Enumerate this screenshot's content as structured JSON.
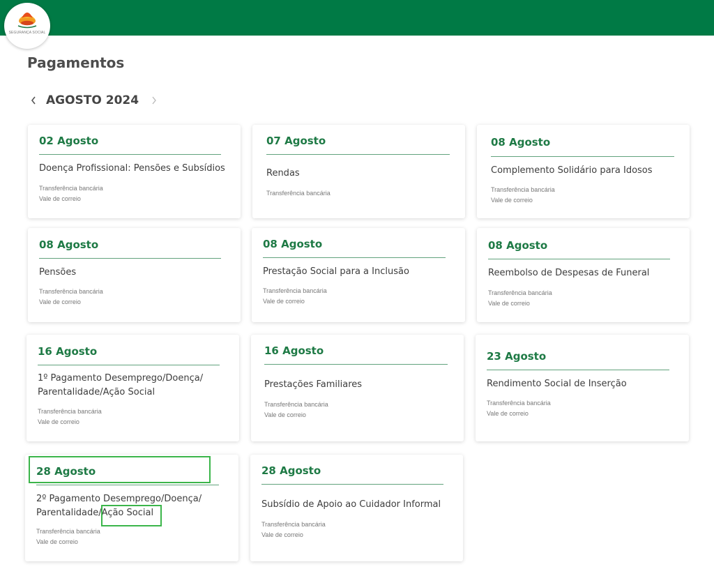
{
  "header": {
    "logo_text": "SEGURANÇA SOCIAL",
    "brand_color": "#007a45",
    "icon": "seguranca-social-flower-logo"
  },
  "page": {
    "title": "Pagamentos"
  },
  "month_nav": {
    "label": "AGOSTO 2024",
    "prev_icon": "chevron-left-icon",
    "next_icon": "chevron-right-icon"
  },
  "method_labels": {
    "transfer": "Transferência bancária",
    "mail": "Vale de correio"
  },
  "cards": [
    {
      "date": "02 Agosto",
      "title": "Doença Profissional: Pensões e Subsídios",
      "methods": [
        "Transferência bancária",
        "Vale de correio"
      ]
    },
    {
      "date": "07 Agosto",
      "title": "Rendas",
      "methods": [
        "Transferência bancária"
      ]
    },
    {
      "date": "08 Agosto",
      "title": "Complemento Solidário para Idosos",
      "methods": [
        "Transferência bancária",
        "Vale de correio"
      ]
    },
    {
      "date": "08 Agosto",
      "title": "Pensões",
      "methods": [
        "Transferência bancária",
        "Vale de correio"
      ]
    },
    {
      "date": "08 Agosto",
      "title": "Prestação Social para a Inclusão",
      "methods": [
        "Transferência bancária",
        "Vale de correio"
      ]
    },
    {
      "date": "08 Agosto",
      "title": "Reembolso de Despesas de Funeral",
      "methods": [
        "Transferência bancária",
        "Vale de correio"
      ]
    },
    {
      "date": "16 Agosto",
      "title": "1º Pagamento Desemprego/Doença/ Parentalidade/Ação Social",
      "methods": [
        "Transferência bancária",
        "Vale de correio"
      ]
    },
    {
      "date": "16 Agosto",
      "title": "Prestações Familiares",
      "methods": [
        "Transferência bancária",
        "Vale de correio"
      ]
    },
    {
      "date": "23 Agosto",
      "title": "Rendimento Social de Inserção",
      "methods": [
        "Transferência bancária",
        "Vale de correio"
      ]
    },
    {
      "date": "28 Agosto",
      "title": "2º Pagamento Desemprego/Doença/ Parentalidade/Ação Social",
      "methods": [
        "Transferência bancária",
        "Vale de correio"
      ]
    },
    {
      "date": "28 Agosto",
      "title": "Subsídio de Apoio ao Cuidador Informal",
      "methods": [
        "Transferência bancária",
        "Vale de correio"
      ]
    }
  ],
  "highlight_color": "#3bb54a"
}
